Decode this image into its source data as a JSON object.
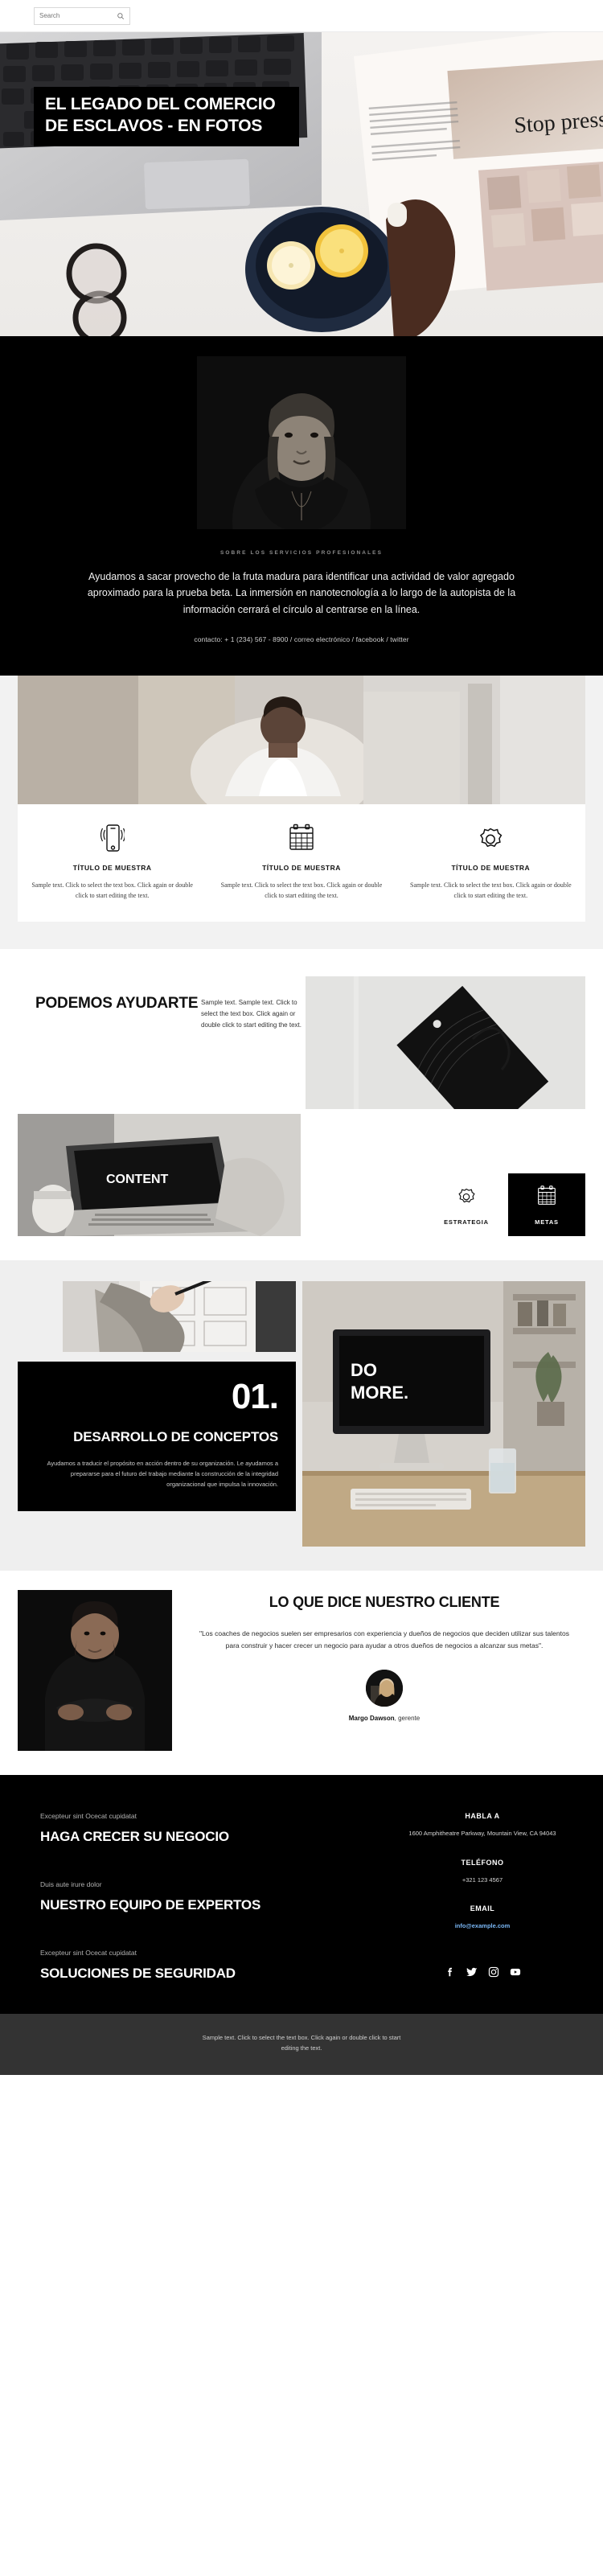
{
  "topbar": {
    "search_placeholder": "Search",
    "search_value": "",
    "search_icon": "search-icon"
  },
  "hero": {
    "title": "EL LEGADO DEL COMERCIO DE ESCLAVOS - EN FOTOS",
    "image_alt": "laptop keyboard, magazine with Stop press headline, bowl with lemon slices, eyeglasses on white desk"
  },
  "about": {
    "portrait_alt": "black and white portrait of a young woman on dark background",
    "eyebrow": "SOBRE LOS SERVICIOS PROFESIONALES",
    "paragraph": "Ayudamos a sacar provecho de la fruta madura para identificar una actividad de valor agregado aproximado para la prueba beta. La inmersión en nanotecnología a lo largo de la autopista de la información cerrará el círculo al centrarse en la línea.",
    "contact": "contacto: + 1 (234) 567 - 8900 / correo electrónico / facebook / twitter"
  },
  "features": {
    "image_alt": "woman in white top sitting on a sofa near a window",
    "columns": [
      {
        "icon": "mobile-signal-icon",
        "title": "TÍTULO DE MUESTRA",
        "text": "Sample text. Click to select the text box. Click again or double click to start editing the text."
      },
      {
        "icon": "calendar-icon",
        "title": "TÍTULO DE MUESTRA",
        "text": "Sample text. Click to select the text box. Click again or double click to start editing the text."
      },
      {
        "icon": "gear-icon",
        "title": "TÍTULO DE MUESTRA",
        "text": "Sample text. Click to select the text box. Click again or double click to start editing the text."
      }
    ]
  },
  "help": {
    "heading": "PODEMOS AYUDARTE",
    "text": "Sample text. Sample text. Click to select the text box. Click again or double click to start editing the text.",
    "tag_image_alt": "black paper shopping tag with cord on light grey surface",
    "laptop_image_alt": "person typing on a laptop showing the word CONTENT",
    "tiles": [
      {
        "icon": "gear-icon",
        "label": "ESTRATEGIA",
        "style": "light"
      },
      {
        "icon": "calendar-icon",
        "label": "METAS",
        "style": "dark"
      }
    ]
  },
  "concepts": {
    "photo_alt": "hand writing notes on a sketch pad with a pen",
    "number": "01.",
    "title": "DESARROLLO DE CONCEPTOS",
    "text": "Ayudamos a traducir el propósito en acción dentro de su organización. Le ayudamos a prepararse para el futuro del trabajo mediante la construcción de la integridad organizacional que impulsa la innovación.",
    "right_image_alt": "desktop computer on a wooden desk displaying DO MORE on screen",
    "right_image_text": "DO MORE."
  },
  "testimonial": {
    "photo_alt": "man in a black t-shirt with arms crossed on a dark background",
    "heading": "LO QUE DICE NUESTRO CLIENTE",
    "quote": "\"Los coaches de negocios suelen ser empresarios con experiencia y dueños de negocios que deciden utilizar sus talentos para construir y hacer crecer un negocio para ayudar a otros dueños de negocios a alcanzar sus metas\".",
    "avatar_alt": "portrait of a blonde woman",
    "author_name": "Margo Dawson",
    "author_role": ", gerente"
  },
  "footer": {
    "blocks": [
      {
        "kicker": "Excepteur sint Ocecat cupidatat",
        "headline": "HAGA CRECER SU NEGOCIO"
      },
      {
        "kicker": "Duis aute irure dolor",
        "headline": "NUESTRO EQUIPO DE EXPERTOS"
      },
      {
        "kicker": "Excepteur sint Ocecat cupidatat",
        "headline": "SOLUCIONES DE SEGURIDAD"
      }
    ],
    "contact": {
      "address_title": "HABLA A",
      "address": "1600 Amphitheatre Parkway, Mountain View, CA 94043",
      "phone_title": "TELÉFONO",
      "phone": "+321 123 4567",
      "email_title": "EMAIL",
      "email": "info@example.com",
      "email_color": "#7ab7f5"
    },
    "socials": [
      {
        "icon": "facebook-icon",
        "name": "facebook"
      },
      {
        "icon": "twitter-icon",
        "name": "twitter"
      },
      {
        "icon": "instagram-icon",
        "name": "instagram"
      },
      {
        "icon": "youtube-icon",
        "name": "youtube"
      }
    ]
  },
  "bottombar": {
    "text": "Sample text. Click to select the text box. Click again or double click to start editing the text."
  },
  "colors": {
    "dark": "#000000",
    "page_grey": "#f2f2f2",
    "bottom_bar": "#333333",
    "link_blue": "#7ab7f5"
  }
}
